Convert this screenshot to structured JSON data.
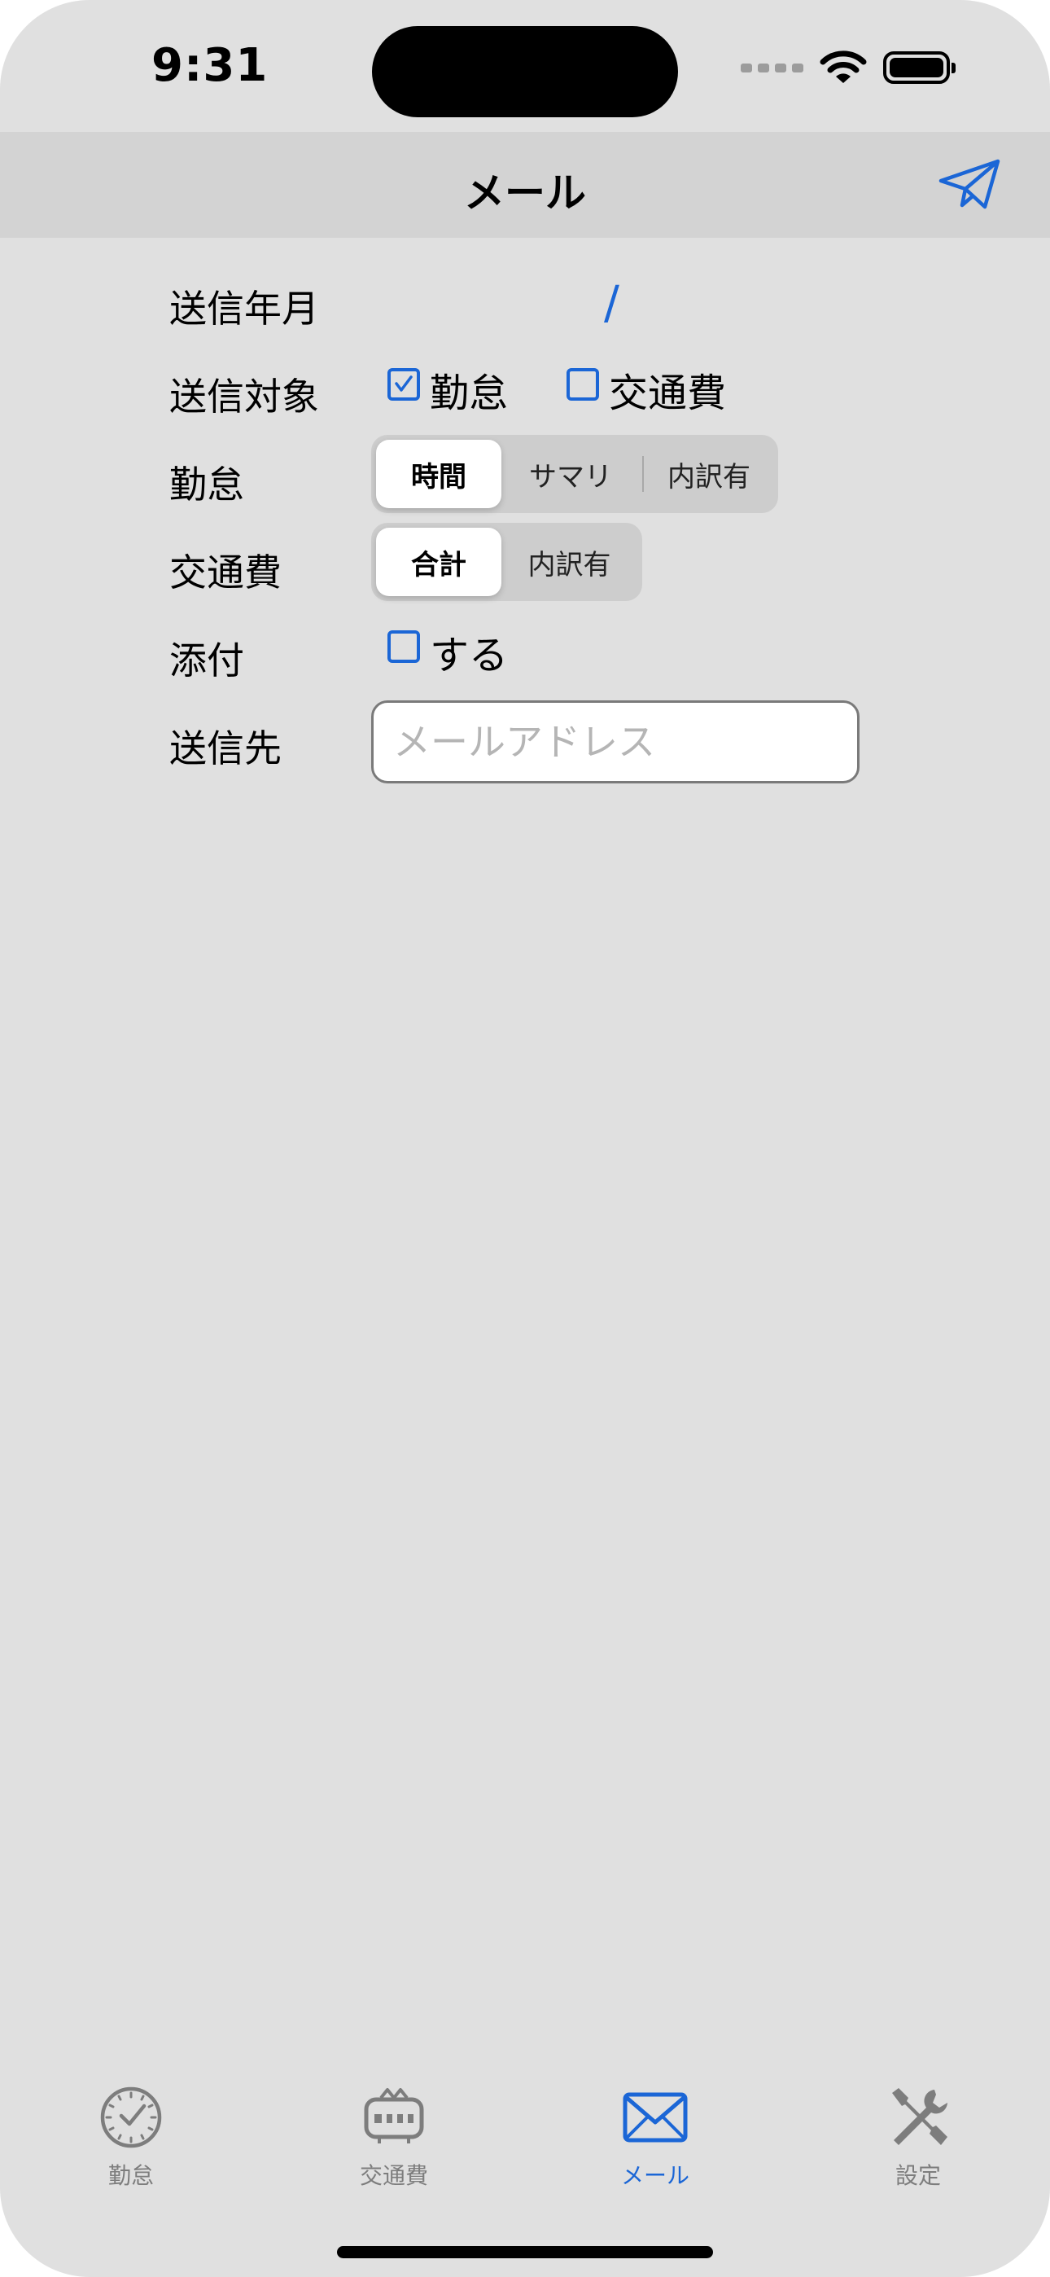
{
  "status_bar": {
    "time": "9:31"
  },
  "nav": {
    "title": "メール",
    "send_icon": "paper-plane-icon"
  },
  "form": {
    "send_month": {
      "label": "送信年月",
      "value": "/"
    },
    "send_target": {
      "label": "送信対象",
      "options": [
        {
          "label": "勤怠",
          "checked": true
        },
        {
          "label": "交通費",
          "checked": false
        }
      ]
    },
    "attendance": {
      "label": "勤怠",
      "segments": [
        "時間",
        "サマリ",
        "内訳有"
      ],
      "selected": "時間"
    },
    "transport": {
      "label": "交通費",
      "segments": [
        "合計",
        "内訳有"
      ],
      "selected": "合計"
    },
    "attachment": {
      "label": "添付",
      "option": {
        "label": "する",
        "checked": false
      }
    },
    "recipient": {
      "label": "送信先",
      "value": "",
      "placeholder": "メールアドレス"
    }
  },
  "tab_bar": {
    "items": [
      {
        "label": "勤怠",
        "icon": "clock-icon",
        "active": false
      },
      {
        "label": "交通費",
        "icon": "train-icon",
        "active": false
      },
      {
        "label": "メール",
        "icon": "envelope-icon",
        "active": true
      },
      {
        "label": "設定",
        "icon": "tools-icon",
        "active": false
      }
    ]
  },
  "colors": {
    "accent": "#1b66d6",
    "background": "#e0e0e0",
    "nav_background": "#d3d3d3",
    "inactive": "#7d7d7d"
  }
}
